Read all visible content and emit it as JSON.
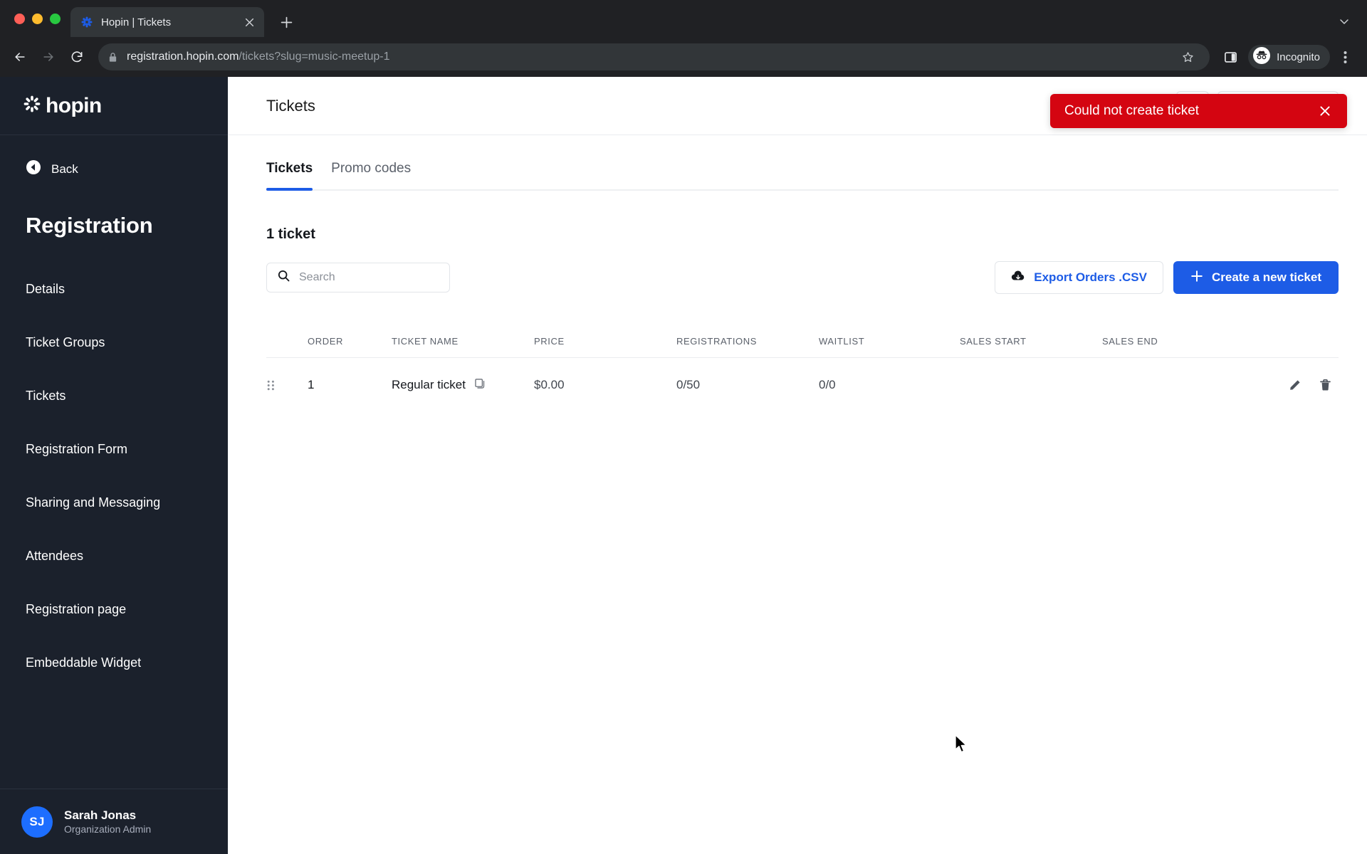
{
  "browser": {
    "tab": {
      "title": "Hopin | Tickets",
      "favicon_icon": "hopin-favicon",
      "close_icon": "close-icon"
    },
    "newtab_icon": "plus-icon",
    "tabstrip_chevron_icon": "chevron-down-icon",
    "nav": {
      "back_icon": "arrow-left-icon",
      "forward_icon": "arrow-right-icon",
      "reload_icon": "reload-icon"
    },
    "omnibox": {
      "lock_icon": "lock-icon",
      "url_host": "registration.hopin.com",
      "url_path": "/tickets?slug=music-meetup-1"
    },
    "bookmark_icon": "star-icon",
    "sidepanel_icon": "side-panel-icon",
    "incognito": {
      "label": "Incognito",
      "icon": "incognito-icon"
    },
    "menu_icon": "three-dot-menu-icon"
  },
  "sidebar": {
    "logo_text": "hopin",
    "logo_icon": "hopin-logo-icon",
    "back": {
      "label": "Back",
      "icon": "circle-arrow-left-icon"
    },
    "section_title": "Registration",
    "items": [
      {
        "label": "Details"
      },
      {
        "label": "Ticket Groups"
      },
      {
        "label": "Tickets"
      },
      {
        "label": "Registration Form"
      },
      {
        "label": "Sharing and Messaging"
      },
      {
        "label": "Attendees"
      },
      {
        "label": "Registration page"
      },
      {
        "label": "Embeddable Widget"
      }
    ],
    "user": {
      "initials": "SJ",
      "name": "Sarah Jonas",
      "role": "Organization Admin",
      "avatar_color": "#1d6eff"
    }
  },
  "header": {
    "title": "Tickets",
    "icon_button_icon": "preview-icon"
  },
  "toast": {
    "message": "Could not create ticket",
    "close_icon": "close-icon",
    "color": "#d40511"
  },
  "main": {
    "tabs": [
      {
        "label": "Tickets",
        "active": true
      },
      {
        "label": "Promo codes",
        "active": false
      }
    ],
    "count_label": "1 ticket",
    "search": {
      "placeholder": "Search",
      "value": "",
      "icon": "search-icon"
    },
    "export_button": {
      "label": "Export Orders .CSV",
      "icon": "cloud-download-icon"
    },
    "create_button": {
      "label": "Create a new ticket",
      "icon": "plus-icon"
    },
    "accent_color": "#1d5ce6",
    "table": {
      "columns": [
        "ORDER",
        "TICKET NAME",
        "PRICE",
        "REGISTRATIONS",
        "WAITLIST",
        "SALES START",
        "SALES END"
      ],
      "rows": [
        {
          "grip_icon": "drag-handle-icon",
          "order": "1",
          "ticket_name": "Regular ticket",
          "name_badge_icon": "copy-icon",
          "price": "$0.00",
          "registrations": "0/50",
          "waitlist": "0/0",
          "sales_start": "",
          "sales_end": "",
          "edit_icon": "pencil-icon",
          "delete_icon": "trash-icon"
        }
      ]
    }
  }
}
